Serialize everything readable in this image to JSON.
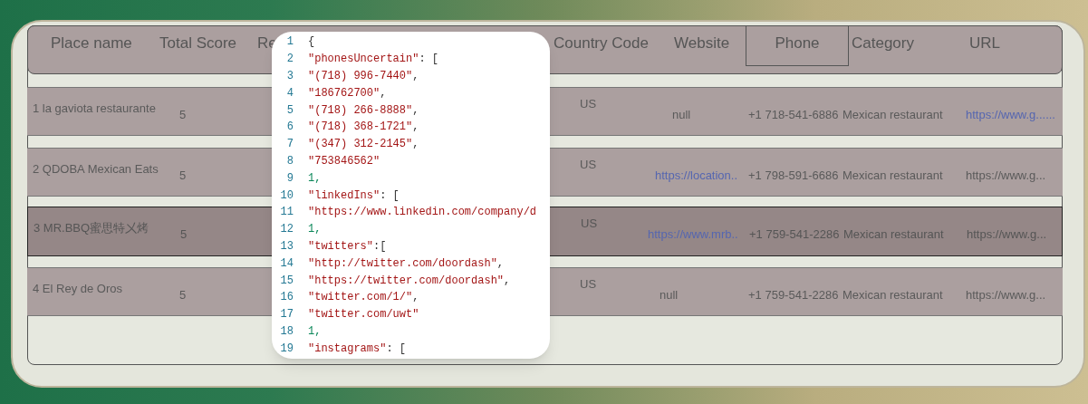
{
  "columns": [
    {
      "label": "Place name",
      "selected": false
    },
    {
      "label": "Total Score",
      "selected": false
    },
    {
      "label": "Re",
      "selected": false
    },
    {
      "label": "Country Code",
      "selected": false
    },
    {
      "label": "Website",
      "selected": false
    },
    {
      "label": "Phone",
      "selected": true
    },
    {
      "label": "Category",
      "selected": false
    },
    {
      "label": "URL",
      "selected": false
    }
  ],
  "rows": [
    {
      "place_name": "1 la gaviota restaurante",
      "total_score": "5",
      "country_code": "US",
      "website": {
        "text": "null",
        "link": false
      },
      "phone": "+1 718-541-6886",
      "category": "Mexican restaurant",
      "url": {
        "text": "https://www.g......",
        "link": true
      },
      "selected": false
    },
    {
      "place_name": "2 QDOBA Mexican Eats",
      "total_score": "5",
      "country_code": "US",
      "website": {
        "text": "https://location..",
        "link": true
      },
      "phone": "+1 798-591-6686",
      "category": "Mexican restaurant",
      "url": {
        "text": "https://www.g...",
        "link": false
      },
      "selected": false
    },
    {
      "place_name": "3 MR.BBQ蜜思特㐅烤",
      "total_score": "5",
      "country_code": "US",
      "website": {
        "text": "https://www.mrb..",
        "link": true
      },
      "phone": "+1 759-541-2286",
      "category": "Mexican restaurant",
      "url": {
        "text": "https://www.g...",
        "link": false
      },
      "selected": true
    },
    {
      "place_name": "4 El Rey de Oros",
      "total_score": "5",
      "country_code": "US",
      "website": {
        "text": "null",
        "link": false
      },
      "phone": "+1 759-541-2286",
      "category": "Mexican restaurant",
      "url": {
        "text": "https://www.g...",
        "link": false
      },
      "selected": false
    }
  ],
  "code_popup": {
    "lines": [
      {
        "number": "1",
        "text": "{"
      },
      {
        "number": "2",
        "text": "\"phonesUncertain\": ["
      },
      {
        "number": "3",
        "text": "\"(718) 996-7440\","
      },
      {
        "number": "4",
        "text": "\"186762700\","
      },
      {
        "number": "5",
        "text": "\"(718) 266-8888\","
      },
      {
        "number": "6",
        "text": "\"(718) 368-1721\","
      },
      {
        "number": "7",
        "text": "\"(347) 312-2145\","
      },
      {
        "number": "8",
        "text": "\"753846562\""
      },
      {
        "number": "9",
        "text": "1,"
      },
      {
        "number": "10",
        "text": "\"linkedIns\": ["
      },
      {
        "number": "11",
        "text": "\"https://www.linkedin.com/company/d"
      },
      {
        "number": "12",
        "text": "1,"
      },
      {
        "number": "13",
        "text": "\"twitters\":["
      },
      {
        "number": "14",
        "text": "\"http://twitter.com/doordash\","
      },
      {
        "number": "15",
        "text": "\"https://twitter.com/doordash\","
      },
      {
        "number": "16",
        "text": "\"twitter.com/1/\","
      },
      {
        "number": "17",
        "text": "\"twitter.com/uwt\""
      },
      {
        "number": "18",
        "text": "1,"
      },
      {
        "number": "19",
        "text": "\"instagrams\": ["
      }
    ]
  }
}
